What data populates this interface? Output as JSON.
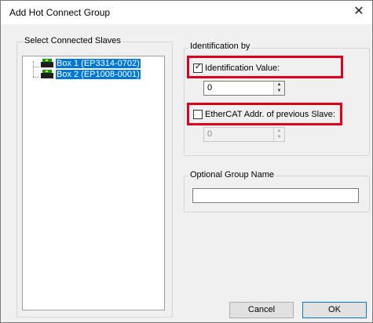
{
  "window": {
    "title": "Add Hot Connect Group",
    "close_glyph": "✕"
  },
  "slaves_panel": {
    "label": "Select Connected Slaves",
    "items": [
      {
        "label": "Box 1 (EP3314-0702)",
        "icon": "ethercat-box-icon"
      },
      {
        "label": "Box 2 (EP1008-0001)",
        "icon": "ethercat-box-icon"
      }
    ]
  },
  "identification": {
    "label": "Identification by",
    "identification_value": {
      "label": "Identification Value:",
      "checked": true,
      "value": "0"
    },
    "ethercat_addr": {
      "label": "EtherCAT Addr. of previous Slave:",
      "checked": false,
      "value": "0"
    }
  },
  "group_name": {
    "label": "Optional Group Name",
    "value": ""
  },
  "buttons": {
    "cancel": "Cancel",
    "ok": "OK"
  },
  "colors": {
    "highlight": "#e0001b",
    "selection": "#0078d7"
  }
}
